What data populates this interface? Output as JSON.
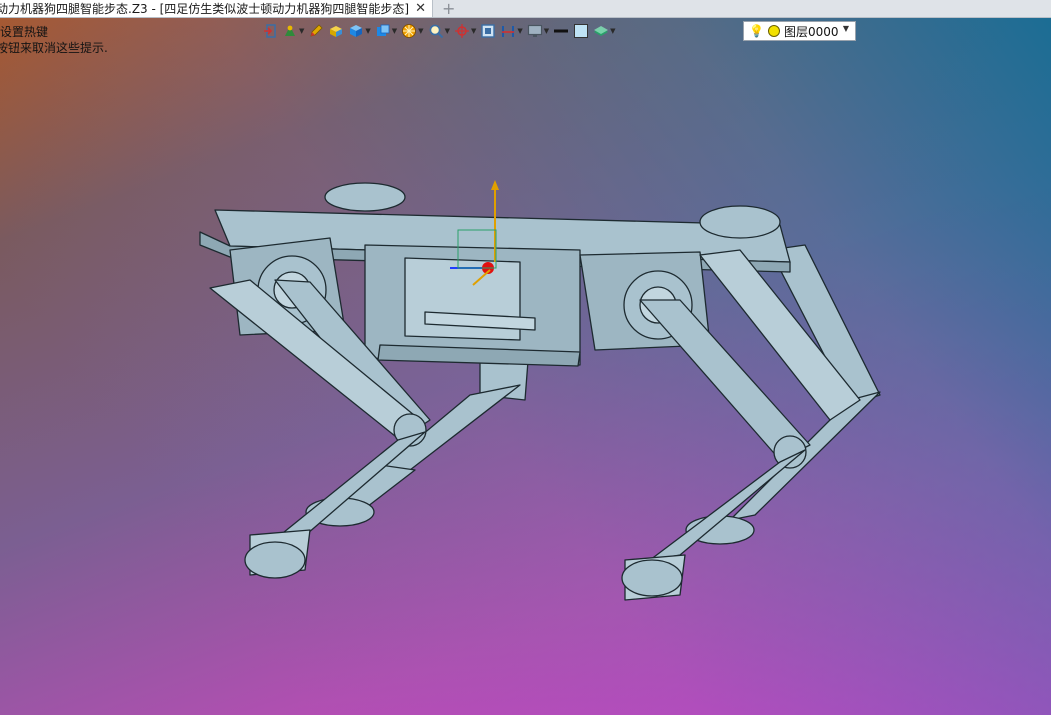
{
  "tab": {
    "title": "动力机器狗四腿智能步态.Z3 - [四足仿生类似波士顿动力机器狗四腿智能步态]",
    "close_glyph": "✕",
    "add_glyph": "+"
  },
  "hint": {
    "line1": "设置热键",
    "line2": "按钮来取消这些提示."
  },
  "toolbar": {
    "buttons": [
      {
        "icon": "exit-door-icon",
        "color": "#d03030"
      },
      {
        "icon": "view-orient-icon",
        "color": "#2e8b3a"
      },
      {
        "icon": "pencil-icon",
        "color": "#e0a800"
      },
      {
        "icon": "box-solid-icon",
        "color": "#e8b800"
      },
      {
        "icon": "cube-icon",
        "color": "#1e88e5"
      },
      {
        "icon": "cube-stack-icon",
        "color": "#1e88e5"
      },
      {
        "icon": "filter-wheel-icon",
        "color": "#f0a000"
      },
      {
        "icon": "zoom-icon",
        "color": "#f0b400"
      },
      {
        "icon": "target-icon",
        "color": "#d03030"
      },
      {
        "icon": "frame-icon",
        "color": "#3a6ea5"
      },
      {
        "icon": "section-icon",
        "color": "#1e5aa8"
      },
      {
        "icon": "monitor-icon",
        "color": "#4a5560"
      },
      {
        "icon": "line-weight-icon",
        "color": "#111111"
      },
      {
        "icon": "color-swatch-icon",
        "color": "#bfe3f5"
      },
      {
        "icon": "layer-plane-icon",
        "color": "#2aa06a"
      }
    ]
  },
  "layer": {
    "value": "图层0000"
  },
  "colors": {
    "part": "#a9c2ce",
    "edge": "#1d2a30",
    "axis_y": "#e0a000",
    "axis_x": "#1e3cff",
    "axis_z": "#e01010"
  }
}
